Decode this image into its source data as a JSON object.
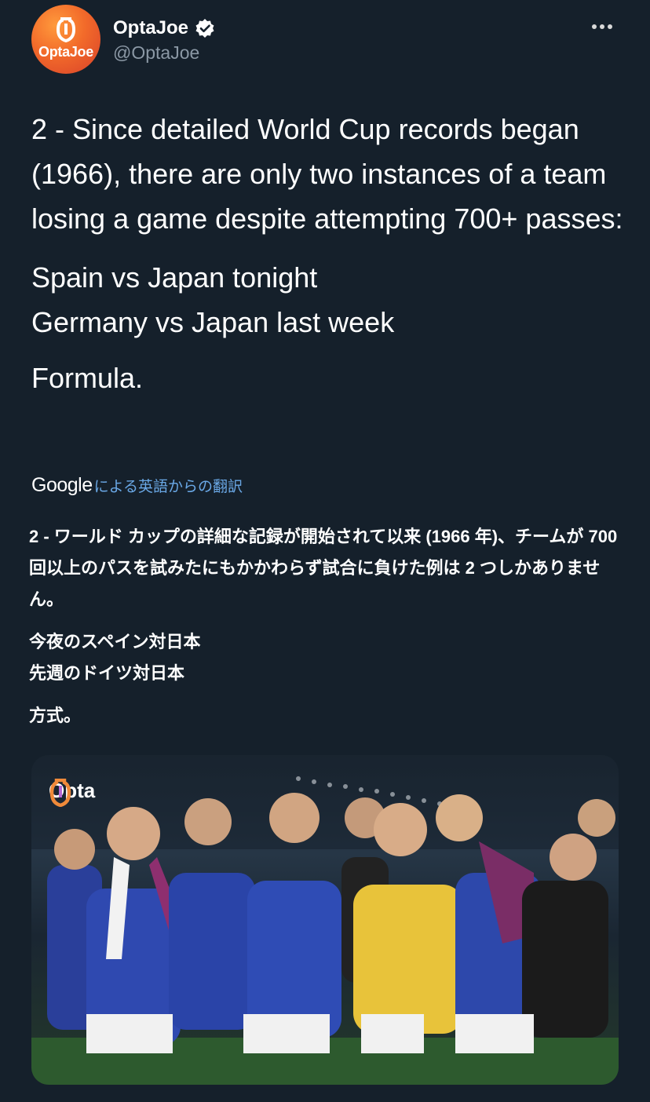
{
  "account": {
    "display_name": "OptaJoe",
    "handle": "@OptaJoe",
    "avatar_text": "OptaJoe",
    "verified": true,
    "brand_color": "#f26a2a"
  },
  "tweet": {
    "paragraph1": "2 - Since detailed World Cup records began (1966), there are only two instances of a team losing a game despite attempting 700+ passes:",
    "line1": "Spain vs Japan tonight",
    "line2": "Germany vs Japan last week",
    "paragraph3": "Formula."
  },
  "translation": {
    "brand": "Google",
    "label": "による英語からの翻訳",
    "paragraph1": "2 - ワールド カップの詳細な記録が開始されて以来 (1966 年)、チームが 700 回以上のパスを試みたにもかかわらず試合に負けた例は 2 つしかありません。",
    "line1": "今夜のスペイン対日本",
    "line2": "先週のドイツ対日本",
    "paragraph3": "方式。"
  },
  "media": {
    "watermark": "Opta",
    "description_icon": "photo-icon"
  },
  "colors": {
    "background": "#15202b",
    "text_primary": "#ffffff",
    "text_secondary": "#8b98a5",
    "link": "#6aa8e6"
  }
}
